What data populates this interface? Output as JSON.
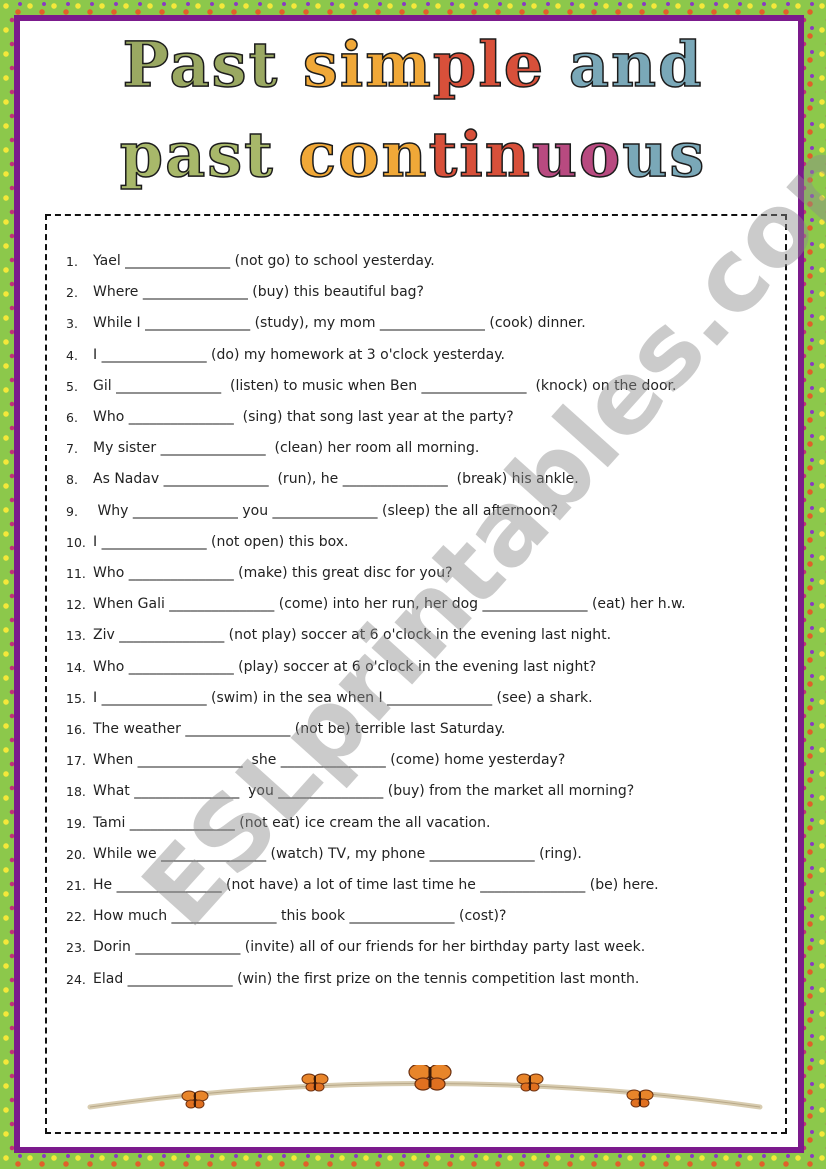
{
  "title": {
    "line1": [
      {
        "text": "Past",
        "color": "#9aa862"
      },
      {
        "text": " ",
        "color": "#ffffff"
      },
      {
        "text": "sim",
        "color": "#f0a838"
      },
      {
        "text": "ple",
        "color": "#d8503a"
      },
      {
        "text": " ",
        "color": "#ffffff"
      },
      {
        "text": "and",
        "color": "#7aa8b8"
      }
    ],
    "line2": [
      {
        "text": "past",
        "color": "#a8b86a"
      },
      {
        "text": " ",
        "color": "#ffffff"
      },
      {
        "text": "con",
        "color": "#f0a838"
      },
      {
        "text": "tin",
        "color": "#d8503a"
      },
      {
        "text": "uo",
        "color": "#b84a80"
      },
      {
        "text": "us",
        "color": "#7aa8b8"
      }
    ]
  },
  "exercises": [
    {
      "num": "1.",
      "text": "Yael _______________ (not go) to school yesterday."
    },
    {
      "num": "2.",
      "text": "Where _______________ (buy) this beautiful bag?"
    },
    {
      "num": "3.",
      "text": "While I _______________ (study), my mom _______________ (cook) dinner."
    },
    {
      "num": "4.",
      "text": "I _______________ (do) my homework at 3 o'clock yesterday."
    },
    {
      "num": "5.",
      "text": "Gil _______________  (listen) to music when Ben _______________  (knock) on the door."
    },
    {
      "num": "6.",
      "text": "Who _______________  (sing) that song last year at the party?"
    },
    {
      "num": "7.",
      "text": "My sister _______________  (clean) her room all morning."
    },
    {
      "num": "8.",
      "text": "As Nadav _______________  (run), he _______________  (break) his ankle."
    },
    {
      "num": "9.",
      "text": " Why _______________ you _______________ (sleep) the all afternoon?"
    },
    {
      "num": "10.",
      "text": "I _______________ (not open) this box."
    },
    {
      "num": "11.",
      "text": "Who _______________ (make) this great disc for you?"
    },
    {
      "num": "12.",
      "text": "When Gali _______________ (come) into her run, her dog _______________ (eat) her h.w."
    },
    {
      "num": "13.",
      "text": "Ziv _______________ (not play) soccer at 6 o'clock in the evening last night."
    },
    {
      "num": "14.",
      "text": "Who _______________ (play) soccer at 6 o'clock in the evening last night?"
    },
    {
      "num": "15.",
      "text": "I _______________ (swim) in the sea when I _______________ (see) a shark."
    },
    {
      "num": "16.",
      "text": "The weather _______________ (not be) terrible last Saturday."
    },
    {
      "num": "17.",
      "text": "When _______________  she _______________ (come) home yesterday?"
    },
    {
      "num": "18.",
      "text": "What _______________  you _______________ (buy) from the market all morning?"
    },
    {
      "num": "19.",
      "text": "Tami _______________ (not eat) ice cream the all vacation."
    },
    {
      "num": "20.",
      "text": "While we _______________ (watch) TV, my phone _______________ (ring)."
    },
    {
      "num": "21.",
      "text": "He _______________ (not have) a lot of time last time he _______________ (be) here."
    },
    {
      "num": "22.",
      "text": "How much _______________ this book _______________ (cost)?"
    },
    {
      "num": "23.",
      "text": "Dorin _______________ (invite) all of our friends for her birthday party last week."
    },
    {
      "num": "24.",
      "text": "Elad _______________ (win) the first prize on the tennis competition last month."
    }
  ],
  "watermark": "ESLprintables.com",
  "colors": {
    "border_green": "#8cc84b",
    "frame_purple": "#7b1a8c",
    "butterfly_orange": "#e8852a",
    "branch": "#d8ccb0"
  }
}
